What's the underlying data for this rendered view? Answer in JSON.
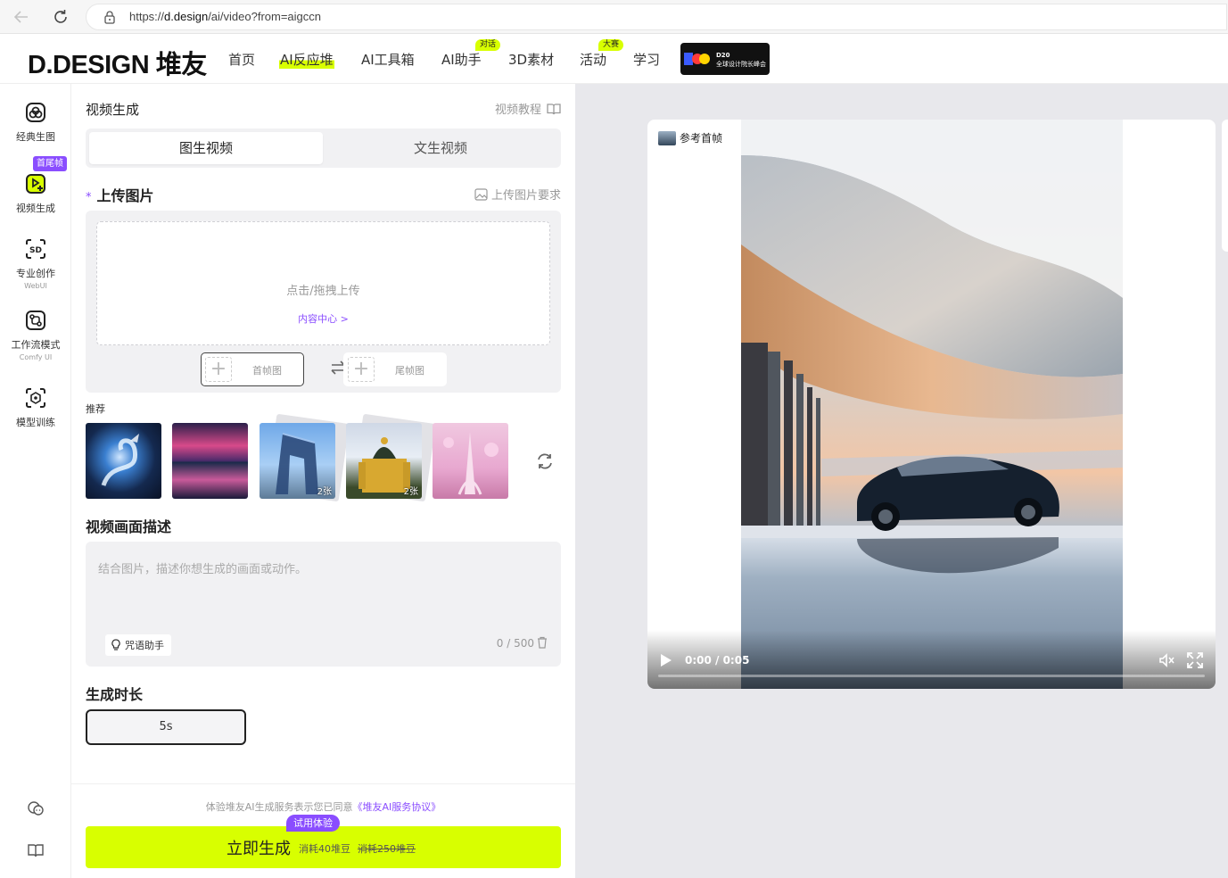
{
  "browser": {
    "url_scheme": "https://",
    "url_host": "d.design",
    "url_path": "/ai/video?from=aigccn"
  },
  "header": {
    "logo": "D.DESIGN 堆友",
    "nav": [
      {
        "label": "首页"
      },
      {
        "label": "AI反应堆"
      },
      {
        "label": "AI工具箱"
      },
      {
        "label": "AI助手",
        "badge": "对话"
      },
      {
        "label": "3D素材"
      },
      {
        "label": "活动",
        "badge": "大赛"
      },
      {
        "label": "学习"
      }
    ],
    "promo": {
      "title": "D20",
      "subtitle": "全球设计院长峰会"
    }
  },
  "sidebar": {
    "items": [
      {
        "label": "经典生图",
        "icon": "palette-icon"
      },
      {
        "label": "视频生成",
        "icon": "video-add-icon",
        "badge": "首尾帧"
      },
      {
        "label": "专业创作",
        "sub": "WebUI",
        "icon": "sd-icon"
      },
      {
        "label": "工作流模式",
        "sub": "Comfy UI",
        "icon": "workflow-icon"
      },
      {
        "label": "模型训练",
        "icon": "model-icon"
      }
    ]
  },
  "panel": {
    "title": "视频生成",
    "tutorial": "视频教程",
    "tabs": [
      {
        "label": "图生视频"
      },
      {
        "label": "文生视频"
      }
    ],
    "upload": {
      "label": "上传图片",
      "requirement": "上传图片要求",
      "hint": "点击/拖拽上传",
      "content_link": "内容中心 >",
      "first_frame": "首帧图",
      "last_frame": "尾帧图"
    },
    "recommend": {
      "label": "推荐",
      "thumbs": [
        {
          "name": "dragon",
          "count": ""
        },
        {
          "name": "galaxy-reflection",
          "count": ""
        },
        {
          "name": "cctv-tower",
          "count": "2张"
        },
        {
          "name": "cathedral",
          "count": "2张"
        },
        {
          "name": "pink-eiffel",
          "count": ""
        }
      ]
    },
    "description": {
      "label": "视频画面描述",
      "placeholder": "结合图片，描述你想生成的画面或动作。",
      "helper": "咒语助手",
      "counter": "0 / 500"
    },
    "duration": {
      "label": "生成时长",
      "value": "5s"
    },
    "agreement": {
      "prefix": "体验堆友AI生成服务表示您已同意",
      "link": "《堆友AI服务协议》"
    },
    "generate": {
      "label": "立即生成",
      "cost": "消耗40堆豆",
      "old_cost": "消耗250堆豆",
      "trial_badge": "试用体验"
    }
  },
  "preview": {
    "ref_tag": "参考首帧",
    "time": "0:00 / 0:05",
    "progress": 0
  },
  "colors": {
    "accent": "#d8ff00",
    "purple": "#8a4dff"
  }
}
